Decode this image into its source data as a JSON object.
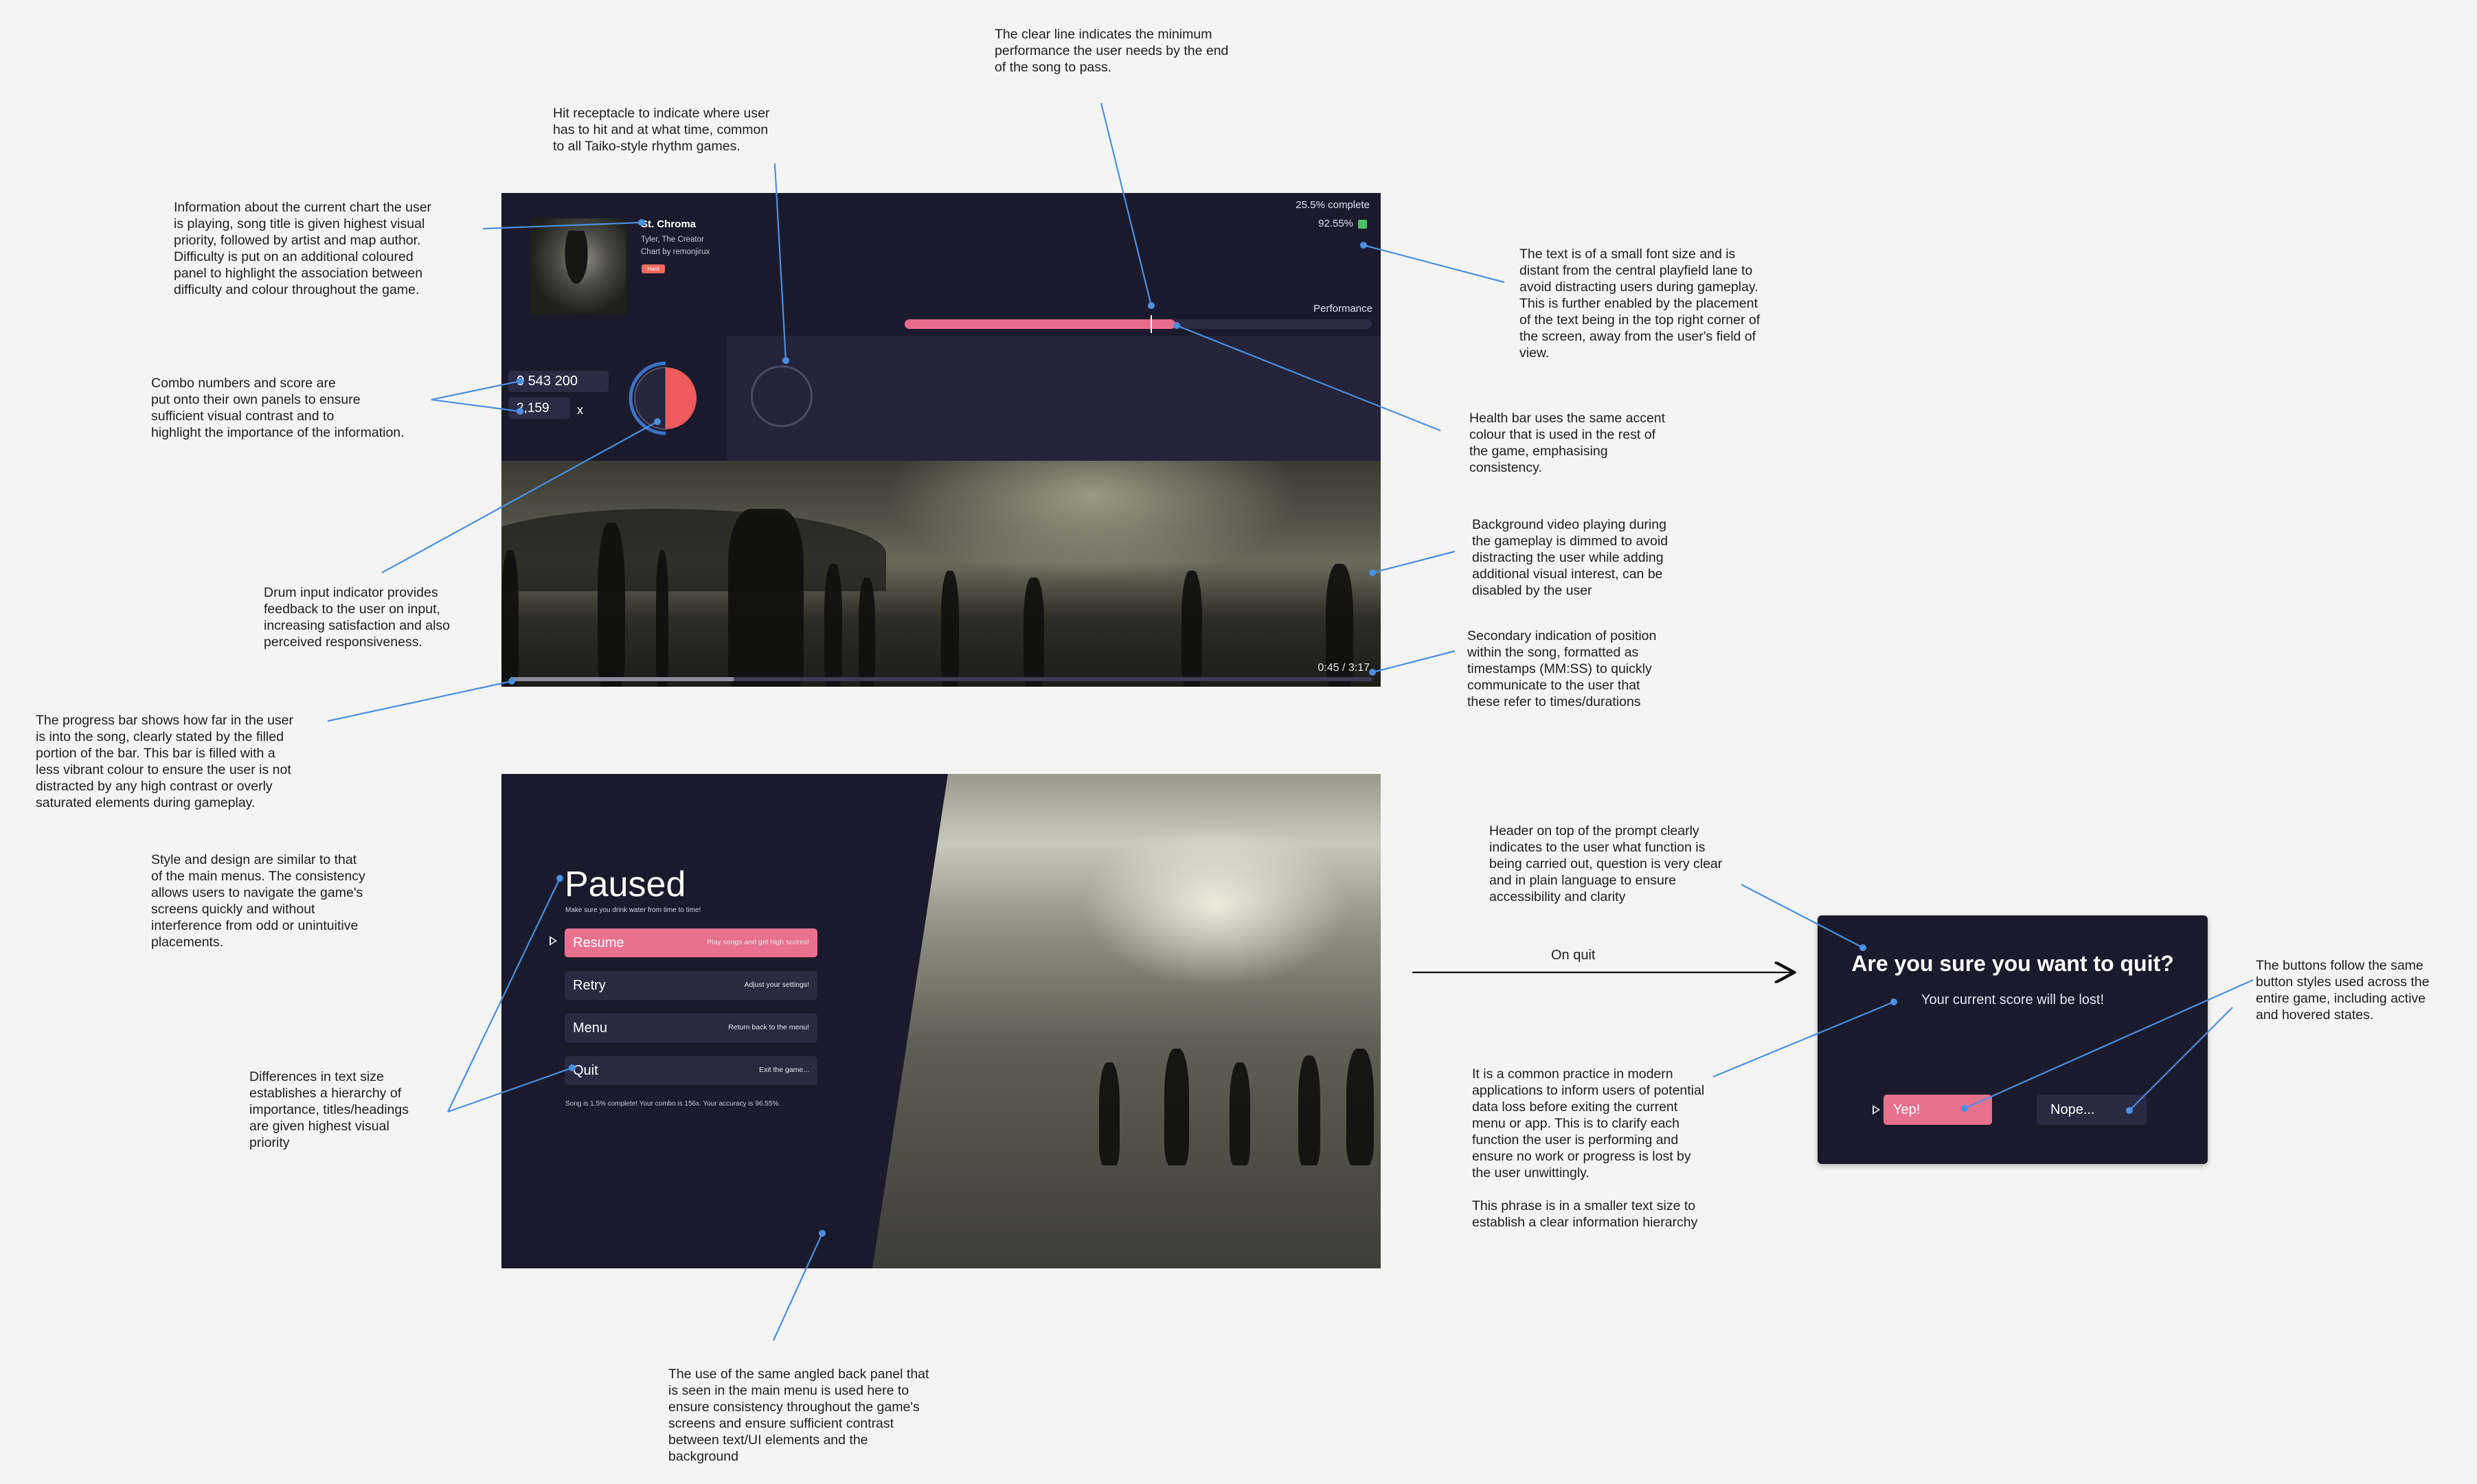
{
  "colors": {
    "background": "#f4f4f4",
    "panel_dark": "#1b1a2c",
    "accent_pink": "#e8718e",
    "annotation_blue": "#4a8fe0",
    "difficulty_orange": "#f06a5c",
    "accuracy_green": "#4bbf63"
  },
  "gameplay": {
    "song_title": "St. Chroma",
    "artist": "Tyler, The Creator",
    "chart_author": "Chart by remonjirux",
    "difficulty_badge": "Hard",
    "completion": "25.5% complete",
    "accuracy": "92.55%",
    "performance_label": "Performance",
    "health_fraction": 0.58,
    "clear_threshold_fraction": 0.527,
    "score": "0 543 200",
    "combo": "2,159",
    "combo_suffix": "x",
    "song_progress_fraction": 0.26,
    "timecode": "0:45 / 3:17"
  },
  "pause": {
    "title": "Paused",
    "tip": "Make sure you drink water from time to time!",
    "buttons": [
      {
        "label": "Resume",
        "hint": "Play songs and get high scores!"
      },
      {
        "label": "Retry",
        "hint": "Adjust your settings!"
      },
      {
        "label": "Menu",
        "hint": "Return back to the menu!"
      },
      {
        "label": "Quit",
        "hint": "Exit the game..."
      }
    ],
    "status": "Song is 1.5% complete! Your combo is 156x. Your accuracy is 96.55%."
  },
  "transition_label": "On quit",
  "quit_dialog": {
    "title": "Are you sure you want to quit?",
    "subtitle": "Your current score will be lost!",
    "yes": "Yep!",
    "no": "Nope..."
  },
  "annotations": {
    "chart_info": "Information about the current chart the user\nis playing, song title is given highest visual\npriority, followed by artist and map author.\nDifficulty is put on an additional coloured\npanel to highlight the association between\ndifficulty and colour throughout the game.",
    "hit_receptacle": "Hit receptacle to indicate where user\nhas to hit and at what time, common\nto all Taiko-style rhythm games.",
    "clear_line": "The clear line indicates the minimum\nperformance the user needs by the end\nof the song to pass.",
    "small_text": "The text is of a small font size and is\ndistant from the central playfield lane to\navoid distracting users during gameplay.\nThis is further enabled by the placement\nof the text being in the top right corner of\nthe screen, away from the user's field of\nview.",
    "combo_score": "Combo numbers and score are\nput onto their own panels to ensure\nsufficient visual contrast and to\nhighlight the importance of the information.",
    "health_bar": "Health bar uses the same accent\ncolour that is used in the rest of\nthe game, emphasising\nconsistency.",
    "drum_indicator": "Drum input indicator provides\nfeedback to the user on input,\nincreasing satisfaction and also\nperceived responsiveness.",
    "background_video": "Background video playing during\nthe gameplay is dimmed to avoid\ndistracting the user while adding\nadditional visual interest, can be\ndisabled by the user",
    "timestamp": "Secondary indication of position\nwithin the song, formatted as\ntimestamps (MM:SS) to quickly\ncommunicate to the user that\nthese refer to times/durations",
    "progress_bar": "The progress bar shows how far in the user\nis into the song, clearly stated by the filled\nportion of the bar. This bar is filled with a\nless vibrant colour to ensure the user is not\ndistracted by any high contrast or overly\nsaturated elements during gameplay.",
    "style_design": "Style and design are similar to that\nof the main menus. The consistency\nallows users to navigate the game's\nscreens quickly and without\ninterference from odd or unintuitive\nplacements.",
    "text_size": "Differences in text size\nestablishes a hierarchy of\nimportance, titles/headings\nare given highest visual\npriority",
    "angled_panel": "The use of the same angled back panel that\nis seen in the main menu is used here to\nensure consistency throughout the game's\nscreens and ensure sufficient contrast\nbetween text/UI elements and the\nbackground",
    "header_prompt": "Header on top of the prompt clearly\nindicates to the user what function is\nbeing carried out, question is very clear\nand in plain language to ensure\naccessibility and clarity",
    "button_styles": "The buttons follow the same\nbutton styles used across the\nentire game, including active\nand hovered states.",
    "data_loss": "It is a common practice in modern\napplications to inform users of potential\ndata loss before exiting the current\nmenu or app. This is to clarify each\nfunction the user is performing and\nensure no work or progress is lost by\nthe user unwittingly.\n\nThis phrase is in a smaller text size to\nestablish a clear information hierarchy"
  }
}
